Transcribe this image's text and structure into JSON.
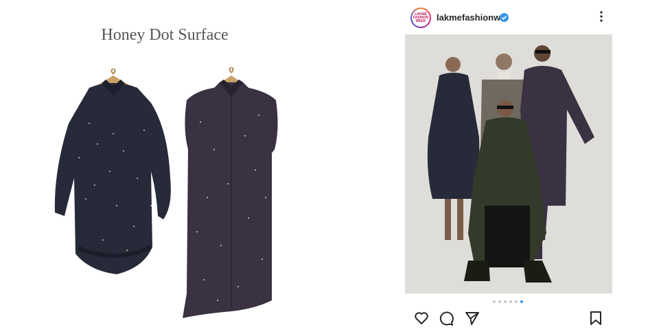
{
  "left_panel": {
    "title": "Honey Dot Surface",
    "garments": [
      "dress-garment",
      "long-vest-garment"
    ]
  },
  "post": {
    "username": "lakmefashionwk",
    "verified": true,
    "avatar_text": "LAKMÉ FASHION WEEK",
    "carousel": {
      "count": 6,
      "active_index": 5
    },
    "icons": {
      "like": "heart-icon",
      "comment": "comment-icon",
      "share": "share-icon",
      "save": "bookmark-icon",
      "more": "more-icon"
    }
  },
  "colors": {
    "accent_blue": "#3897f0",
    "garment_navy": "#2a2d3d",
    "garment_plum": "#3e3444",
    "olive": "#343a2a"
  }
}
